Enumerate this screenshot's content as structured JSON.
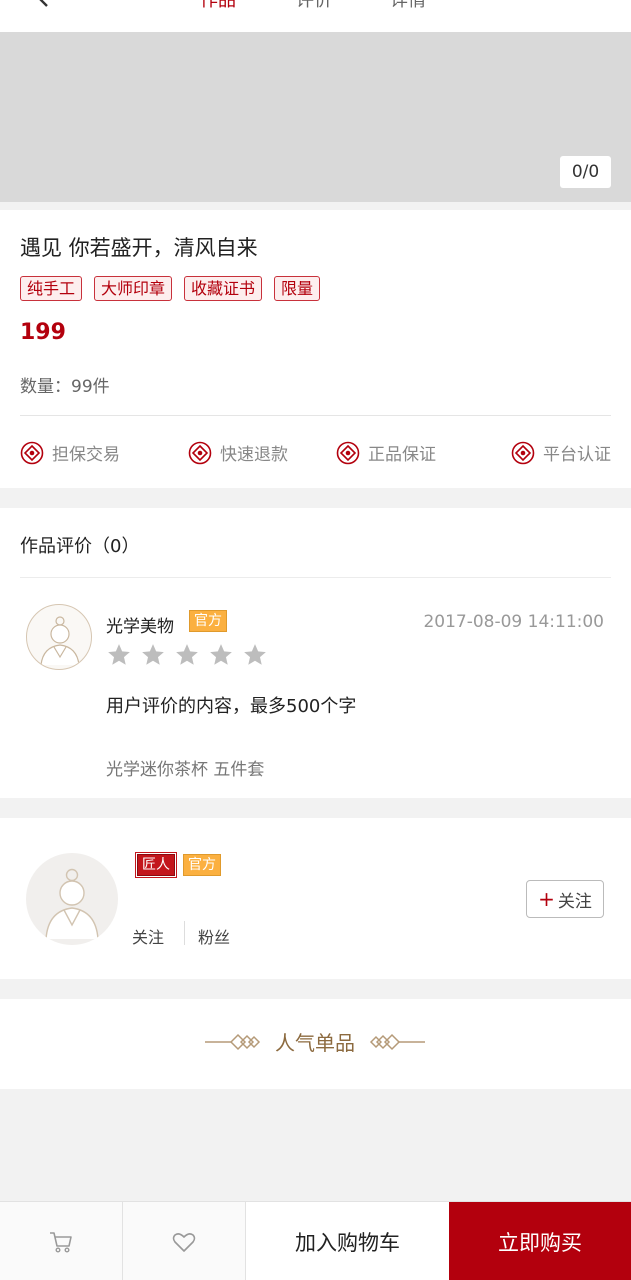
{
  "nav": {
    "tabs": [
      {
        "label": "作品"
      },
      {
        "label": "评价"
      },
      {
        "label": "详情"
      }
    ]
  },
  "gallery": {
    "counter": "0/0"
  },
  "product": {
    "title": "遇见 你若盛开，清风自来",
    "tags": [
      "纯手工",
      "大师印章",
      "收藏证书",
      "限量"
    ],
    "price": "199",
    "quantity": "数量：99件",
    "guarantees": [
      "担保交易",
      "快速退款",
      "正品保证",
      "平台认证"
    ]
  },
  "reviews": {
    "heading": "作品评价（0）",
    "items": [
      {
        "user": "光学美物",
        "badge": "官方",
        "time": "2017-08-09 14:11:00",
        "stars": 5,
        "text": "用户评价的内容，最多500个字",
        "product": "光学迷你茶杯  五件套"
      }
    ]
  },
  "artist": {
    "badges": [
      "匠人",
      "官方"
    ],
    "follow_label": "关注",
    "fans_label": "粉丝",
    "follow_button": "关注"
  },
  "popular": {
    "title": "人气单品"
  },
  "bottom": {
    "add_to_cart": "加入购物车",
    "buy_now": "立即购买"
  },
  "colors": {
    "accent": "#b3000d",
    "official_badge": "#fbb040",
    "gold_text": "#8c6a3f",
    "star_gray": "#bdbdbd"
  },
  "icons": [
    "back-arrow-icon",
    "guarantee-icon",
    "star-icon",
    "cart-icon",
    "heart-icon",
    "knot-ornament-icon",
    "avatar-icon"
  ]
}
